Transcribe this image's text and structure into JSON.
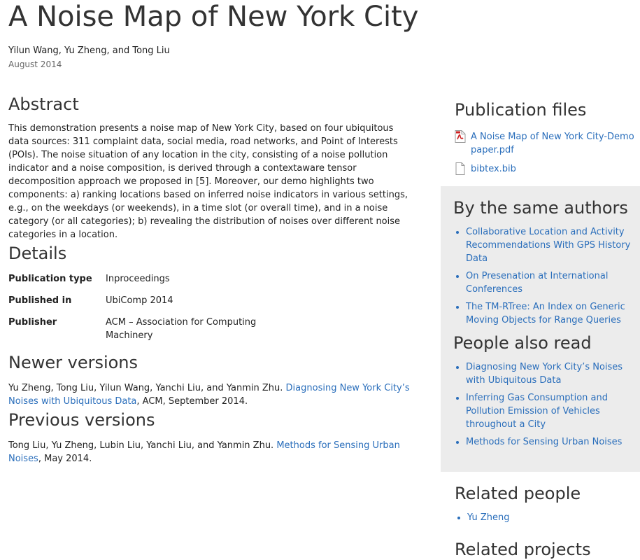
{
  "header": {
    "title": "A Noise Map of New York City",
    "authors": "Yilun Wang, Yu Zheng, and Tong Liu",
    "date": "August 2014"
  },
  "abstract": {
    "heading": "Abstract",
    "text": "This demonstration presents a noise map of New York City, based on four ubiquitous data sources: 311 complaint data, social media, road networks, and Point of Interests (POIs). The noise situation of any location in the city, consisting of a noise pollution indicator and a noise composition, is derived through a contextaware tensor decomposition approach we proposed in [5]. Moreover, our demo highlights two components: a) ranking locations based on inferred noise indicators in various settings, e.g., on the weekdays (or weekends), in a time slot (or overall time), and in a noise category (or all categories); b) revealing the distribution of noises over different noise categories in a location."
  },
  "details": {
    "heading": "Details",
    "rows": [
      {
        "label": "Publication type",
        "value": "Inproceedings"
      },
      {
        "label": "Published in",
        "value": "UbiComp 2014"
      },
      {
        "label": "Publisher",
        "value": "ACM – Association for Computing Machinery"
      }
    ]
  },
  "newer_versions": {
    "heading": "Newer versions",
    "prefix": "Yu Zheng, Tong Liu, Yilun Wang, Yanchi Liu, and Yanmin Zhu. ",
    "link": "Diagnosing New York City’s Noises with Ubiquitous Data",
    "suffix": ", ACM, September 2014."
  },
  "previous_versions": {
    "heading": "Previous versions",
    "prefix": "Tong Liu, Yu Zheng, Lubin Liu, Yanchi Liu, and Yanmin Zhu. ",
    "link": "Methods for Sensing Urban Noises",
    "suffix": ", May 2014."
  },
  "publication_files": {
    "heading": "Publication files",
    "files": [
      {
        "name": "A Noise Map of New York City-Demo paper.pdf",
        "icon": "pdf-file-icon"
      },
      {
        "name": "bibtex.bib",
        "icon": "document-icon"
      }
    ]
  },
  "same_authors": {
    "heading": "By the same authors",
    "items": [
      "Collaborative Location and Activity Recommendations With GPS History Data",
      "On Presenation at International Conferences",
      "The TM-RTree: An Index on Generic Moving Objects for Range Queries"
    ]
  },
  "people_also_read": {
    "heading": "People also read",
    "items": [
      "Diagnosing New York City’s Noises with Ubiquitous Data",
      "Inferring Gas Consumption and Pollution Emission of Vehicles throughout a City",
      "Methods for Sensing Urban Noises"
    ]
  },
  "related_people": {
    "heading": "Related people",
    "items": [
      "Yu Zheng"
    ]
  },
  "related_projects": {
    "heading": "Related projects"
  },
  "colors": {
    "link": "#2a6ebb",
    "sidebar_bg": "#ececec",
    "text": "#222222"
  }
}
